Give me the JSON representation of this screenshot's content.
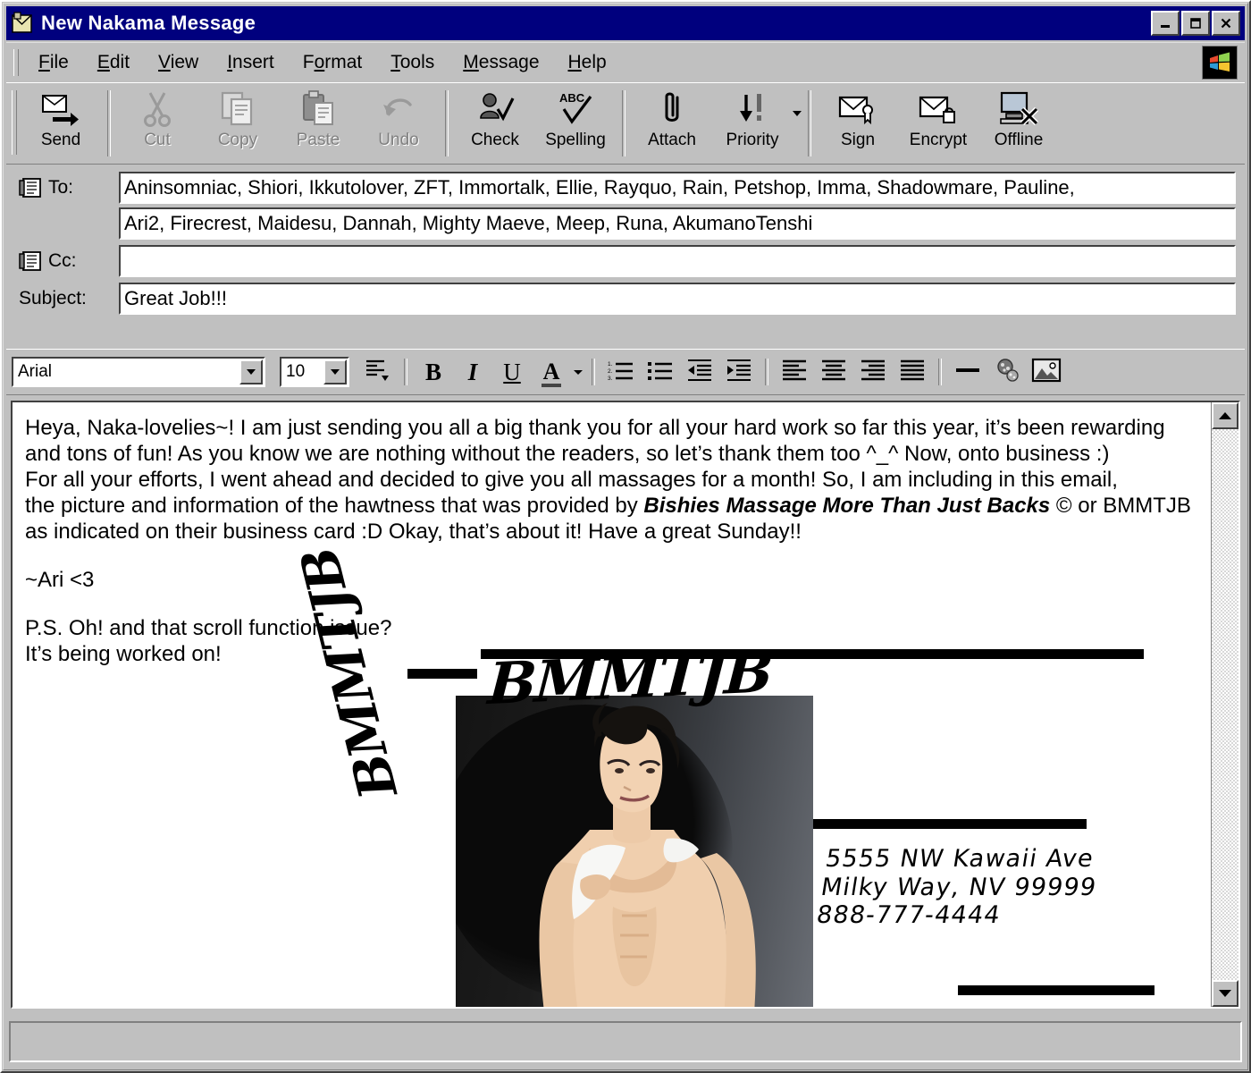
{
  "window": {
    "title": "New Nakama Message",
    "icon": "envelope-window-icon",
    "buttons": {
      "minimize": "_",
      "maximize": "□",
      "close": "✕"
    }
  },
  "menubar": {
    "items": [
      {
        "name": "file",
        "label": "File",
        "accel": "F"
      },
      {
        "name": "edit",
        "label": "Edit",
        "accel": "E"
      },
      {
        "name": "view",
        "label": "View",
        "accel": "V"
      },
      {
        "name": "insert",
        "label": "Insert",
        "accel": "I"
      },
      {
        "name": "format",
        "label": "Format",
        "accel": "o"
      },
      {
        "name": "tools",
        "label": "Tools",
        "accel": "T"
      },
      {
        "name": "message",
        "label": "Message",
        "accel": "M"
      },
      {
        "name": "help",
        "label": "Help",
        "accel": "H"
      }
    ],
    "logo": "windows-flag-logo"
  },
  "toolbar": {
    "buttons": [
      {
        "name": "send",
        "label": "Send",
        "icon": "send-envelope-icon",
        "enabled": true
      },
      {
        "name": "cut",
        "label": "Cut",
        "icon": "scissors-icon",
        "enabled": false
      },
      {
        "name": "copy",
        "label": "Copy",
        "icon": "copy-pages-icon",
        "enabled": false
      },
      {
        "name": "paste",
        "label": "Paste",
        "icon": "clipboard-icon",
        "enabled": false
      },
      {
        "name": "undo",
        "label": "Undo",
        "icon": "undo-arrow-icon",
        "enabled": false
      },
      {
        "name": "check",
        "label": "Check",
        "icon": "check-names-icon",
        "enabled": true
      },
      {
        "name": "spelling",
        "label": "Spelling",
        "icon": "abc-check-icon",
        "enabled": true
      },
      {
        "name": "attach",
        "label": "Attach",
        "icon": "paperclip-icon",
        "enabled": true
      },
      {
        "name": "priority",
        "label": "Priority",
        "icon": "priority-arrow-icon",
        "enabled": true
      },
      {
        "name": "sign",
        "label": "Sign",
        "icon": "sign-envelope-icon",
        "enabled": true
      },
      {
        "name": "encrypt",
        "label": "Encrypt",
        "icon": "lock-envelope-icon",
        "enabled": true
      },
      {
        "name": "offline",
        "label": "Offline",
        "icon": "offline-monitor-icon",
        "enabled": true
      }
    ]
  },
  "headers": {
    "to_label": "To:",
    "cc_label": "Cc:",
    "subject_label": "Subject:",
    "to_line1": "Aninsomniac, Shiori, Ikkutolover, ZFT, Immortalk, Ellie, Rayquo, Rain, Petshop, Imma, Shadowmare, Pauline,",
    "to_line2": "Ari2, Firecrest, Maidesu, Dannah, Mighty Maeve, Meep, Runa, AkumanoTenshi",
    "cc_value": "",
    "subject_value": "Great Job!!!"
  },
  "format_toolbar": {
    "font_name": "Arial",
    "font_size": "10",
    "buttons": [
      {
        "name": "paragraph-style",
        "icon": "paragraph-style-icon"
      },
      {
        "name": "bold",
        "icon": "bold-icon",
        "label": "B"
      },
      {
        "name": "italic",
        "icon": "italic-icon",
        "label": "I"
      },
      {
        "name": "underline",
        "icon": "underline-icon",
        "label": "U"
      },
      {
        "name": "font-color",
        "icon": "font-color-icon",
        "label": "A"
      },
      {
        "name": "numbered-list",
        "icon": "numbered-list-icon"
      },
      {
        "name": "bulleted-list",
        "icon": "bulleted-list-icon"
      },
      {
        "name": "decrease-indent",
        "icon": "decrease-indent-icon"
      },
      {
        "name": "increase-indent",
        "icon": "increase-indent-icon"
      },
      {
        "name": "align-left",
        "icon": "align-left-icon"
      },
      {
        "name": "align-center",
        "icon": "align-center-icon"
      },
      {
        "name": "align-right",
        "icon": "align-right-icon"
      },
      {
        "name": "justify",
        "icon": "justify-icon"
      },
      {
        "name": "horizontal-rule",
        "icon": "horizontal-rule-icon"
      },
      {
        "name": "insert-link",
        "icon": "insert-link-icon"
      },
      {
        "name": "insert-picture",
        "icon": "insert-picture-icon"
      }
    ]
  },
  "body": {
    "line1": "Heya, Naka-lovelies~! I am just sending you all a big thank you for all your hard work so far this year, it’s been rewarding",
    "line2": "and tons of fun! As you know we are nothing without the readers, so let’s thank them too ^_^ Now, onto business :)",
    "line3": "For all your efforts, I went ahead and decided to give you all massages for a month! So, I am including in this email,",
    "line4_pre": "the picture and information of the hawtness that was provided by ",
    "line4_brand": "Bishies Massage More Than Just Backs",
    "line4_post": " © or BMMTJB",
    "line5": "as indicated on their business card :D Okay, that’s about it! Have a great Sunday!!",
    "signature": "~Ari <3",
    "ps_line1": "P.S. Oh! and that scroll function issue?",
    "ps_line2": "It’s being worked on!"
  },
  "business_card": {
    "logo_horizontal": "BMMTJB",
    "logo_vertical": "BMMTJB",
    "photo_alt": "shirtless-male-model-photo",
    "address_line1": "5555 NW Kawaii Ave",
    "address_line2": "Milky Way, NV 99999",
    "address_line3": "888-777-4444"
  },
  "statusbar": {
    "text": ""
  },
  "colors": {
    "titlebar": "#00007e",
    "face": "#c0c0c0",
    "shadow": "#404040",
    "highlight": "#ffffff",
    "field": "#ffffff",
    "disabled_text": "#808080"
  }
}
